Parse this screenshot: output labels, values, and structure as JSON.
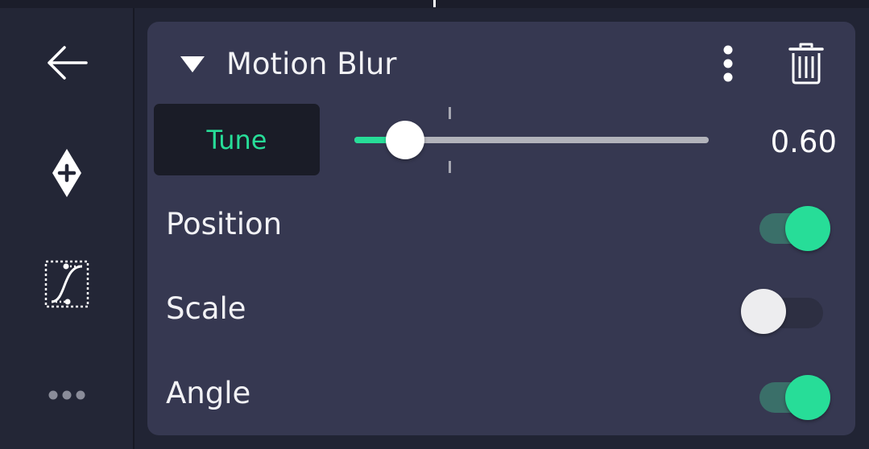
{
  "effect": {
    "title": "Motion Blur",
    "tune_label": "Tune",
    "slider_value": 0.6,
    "slider_value_text": "0.60"
  },
  "params": [
    {
      "label": "Position",
      "enabled": true
    },
    {
      "label": "Scale",
      "enabled": false
    },
    {
      "label": "Angle",
      "enabled": true
    }
  ],
  "sidebar": {
    "icons": [
      "back-arrow-icon",
      "add-keyframe-icon",
      "easing-curve-icon",
      "more-dots-icon"
    ]
  },
  "colors": {
    "accent": "#27dd98",
    "panel_bg": "#363851",
    "sidebar_bg": "#232636"
  }
}
